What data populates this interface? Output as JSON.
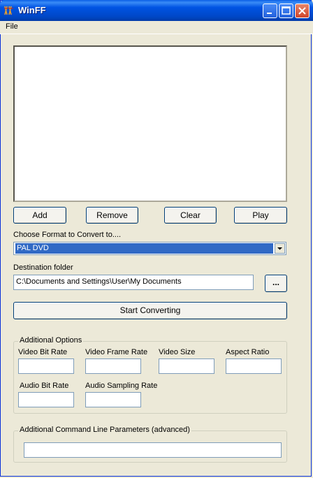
{
  "window": {
    "title": "WinFF"
  },
  "menu": {
    "file": "File"
  },
  "buttons": {
    "add": "Add",
    "remove": "Remove",
    "clear": "Clear",
    "play": "Play",
    "browse": "...",
    "start": "Start Converting"
  },
  "format": {
    "label": "Choose Format to Convert to....",
    "selected": "PAL DVD"
  },
  "destination": {
    "label": "Destination folder",
    "value": "C:\\Documents and Settings\\User\\My Documents"
  },
  "options": {
    "title": "Additional Options",
    "video_bit_rate": "Video Bit Rate",
    "video_frame_rate": "Video Frame Rate",
    "video_size": "Video Size",
    "aspect_ratio": "Aspect Ratio",
    "audio_bit_rate": "Audio Bit Rate",
    "audio_sampling_rate": "Audio Sampling Rate"
  },
  "cmdline": {
    "title": "Additional Command Line Parameters (advanced)"
  }
}
